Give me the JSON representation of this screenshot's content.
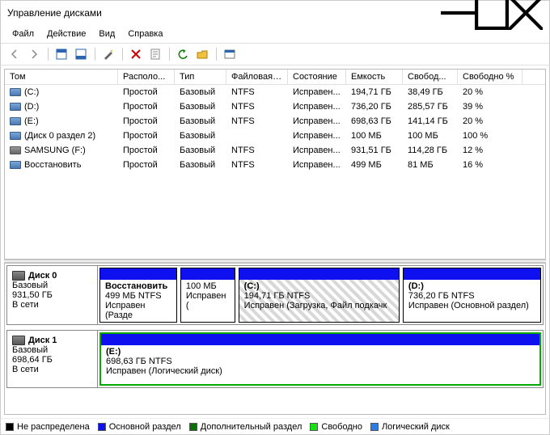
{
  "window": {
    "title": "Управление дисками"
  },
  "menu": {
    "file": "Файл",
    "action": "Действие",
    "view": "Вид",
    "help": "Справка"
  },
  "columns": {
    "tom": "Том",
    "rasp": "Располо...",
    "tip": "Тип",
    "fs": "Файловая с...",
    "st": "Состояние",
    "cap": "Емкость",
    "free": "Свобод...",
    "freepc": "Свободно %"
  },
  "volumes": [
    {
      "icon": "vol",
      "name": "(C:)",
      "layout": "Простой",
      "type": "Базовый",
      "fs": "NTFS",
      "status": "Исправен...",
      "cap": "194,71 ГБ",
      "free": "38,49 ГБ",
      "freepc": "20 %"
    },
    {
      "icon": "vol",
      "name": "(D:)",
      "layout": "Простой",
      "type": "Базовый",
      "fs": "NTFS",
      "status": "Исправен...",
      "cap": "736,20 ГБ",
      "free": "285,57 ГБ",
      "freepc": "39 %"
    },
    {
      "icon": "vol",
      "name": "(E:)",
      "layout": "Простой",
      "type": "Базовый",
      "fs": "NTFS",
      "status": "Исправен...",
      "cap": "698,63 ГБ",
      "free": "141,14 ГБ",
      "freepc": "20 %"
    },
    {
      "icon": "vol",
      "name": "(Диск 0 раздел 2)",
      "layout": "Простой",
      "type": "Базовый",
      "fs": "",
      "status": "Исправен...",
      "cap": "100 МБ",
      "free": "100 МБ",
      "freepc": "100 %"
    },
    {
      "icon": "hdd",
      "name": "SAMSUNG (F:)",
      "layout": "Простой",
      "type": "Базовый",
      "fs": "NTFS",
      "status": "Исправен...",
      "cap": "931,51 ГБ",
      "free": "114,28 ГБ",
      "freepc": "12 %"
    },
    {
      "icon": "vol",
      "name": "Восстановить",
      "layout": "Простой",
      "type": "Базовый",
      "fs": "NTFS",
      "status": "Исправен...",
      "cap": "499 МБ",
      "free": "81 МБ",
      "freepc": "16 %"
    }
  ],
  "disks": [
    {
      "label": "Диск 0",
      "type": "Базовый",
      "size": "931,50 ГБ",
      "status": "В сети",
      "parts": [
        {
          "kind": "primary",
          "title": "Восстановить",
          "line2": "499 МБ NTFS",
          "line3": "Исправен (Разде",
          "flex": 10,
          "sel": false
        },
        {
          "kind": "primary",
          "title": "",
          "line2": "100 МБ",
          "line3": "Исправен (",
          "flex": 7,
          "sel": false
        },
        {
          "kind": "primary",
          "title": "(C:)",
          "line2": "194,71 ГБ NTFS",
          "line3": "Исправен (Загрузка, Файл подкачк",
          "flex": 21,
          "sel": true
        },
        {
          "kind": "primary",
          "title": "(D:)",
          "line2": "736,20 ГБ NTFS",
          "line3": "Исправен (Основной раздел)",
          "flex": 18,
          "sel": false
        }
      ]
    },
    {
      "label": "Диск 1",
      "type": "Базовый",
      "size": "698,64 ГБ",
      "status": "В сети",
      "parts": [
        {
          "kind": "logical",
          "title": "(E:)",
          "line2": "698,63 ГБ NTFS",
          "line3": "Исправен (Логический диск)",
          "flex": 1,
          "sel": false
        }
      ]
    }
  ],
  "legend": {
    "unalloc": "Не распределена",
    "primary": "Основной раздел",
    "extended": "Дополнительный раздел",
    "free": "Свободно",
    "logical": "Логический диск"
  }
}
